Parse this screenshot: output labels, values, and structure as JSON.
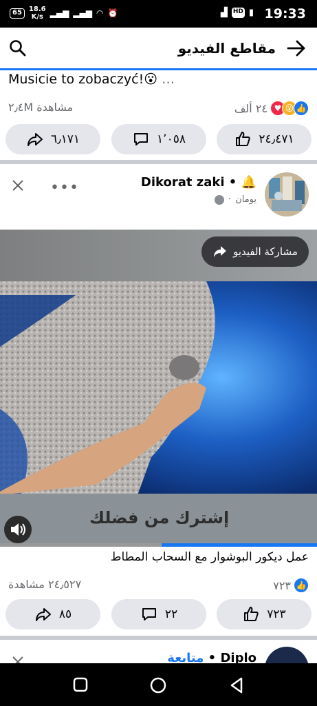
{
  "status_bar": {
    "battery": "65",
    "speed": "18.6",
    "speed_unit": "K/s",
    "time": "19:33",
    "hd": "HD"
  },
  "header": {
    "title": "مقاطع الفيديو"
  },
  "post1": {
    "caption": "Musicie to zobaczyć!😮",
    "caption_more": "…",
    "views": "٢٫٤M مشاهدة",
    "reactions": "٢٤ ألف",
    "like_count": "٢٤٫٤٧١",
    "comment_count": "١٬٠٥٨",
    "share_count": "٦٫١٧١"
  },
  "post2": {
    "page_name": "Dikorat zaki",
    "time": "يومان",
    "video_share_label": "مشاركة الفيديو",
    "overlay_text": "إشترك من فضلك",
    "caption": "عمل ديكور البوشوار مع السحاب المطاط",
    "views": "٢٤٫٥٢٧ مشاهدة",
    "reactions": "٧٢٣",
    "like_count": "٧٢٣",
    "comment_count": "٢٢",
    "share_count": "٨٥",
    "progress": 0.49
  },
  "post3": {
    "page_name": "Diplo",
    "follow_label": "متابعة"
  },
  "colors": {
    "accent": "#1877f2",
    "button_bg": "#e4e6eb",
    "separator": "#c9ccd1"
  }
}
